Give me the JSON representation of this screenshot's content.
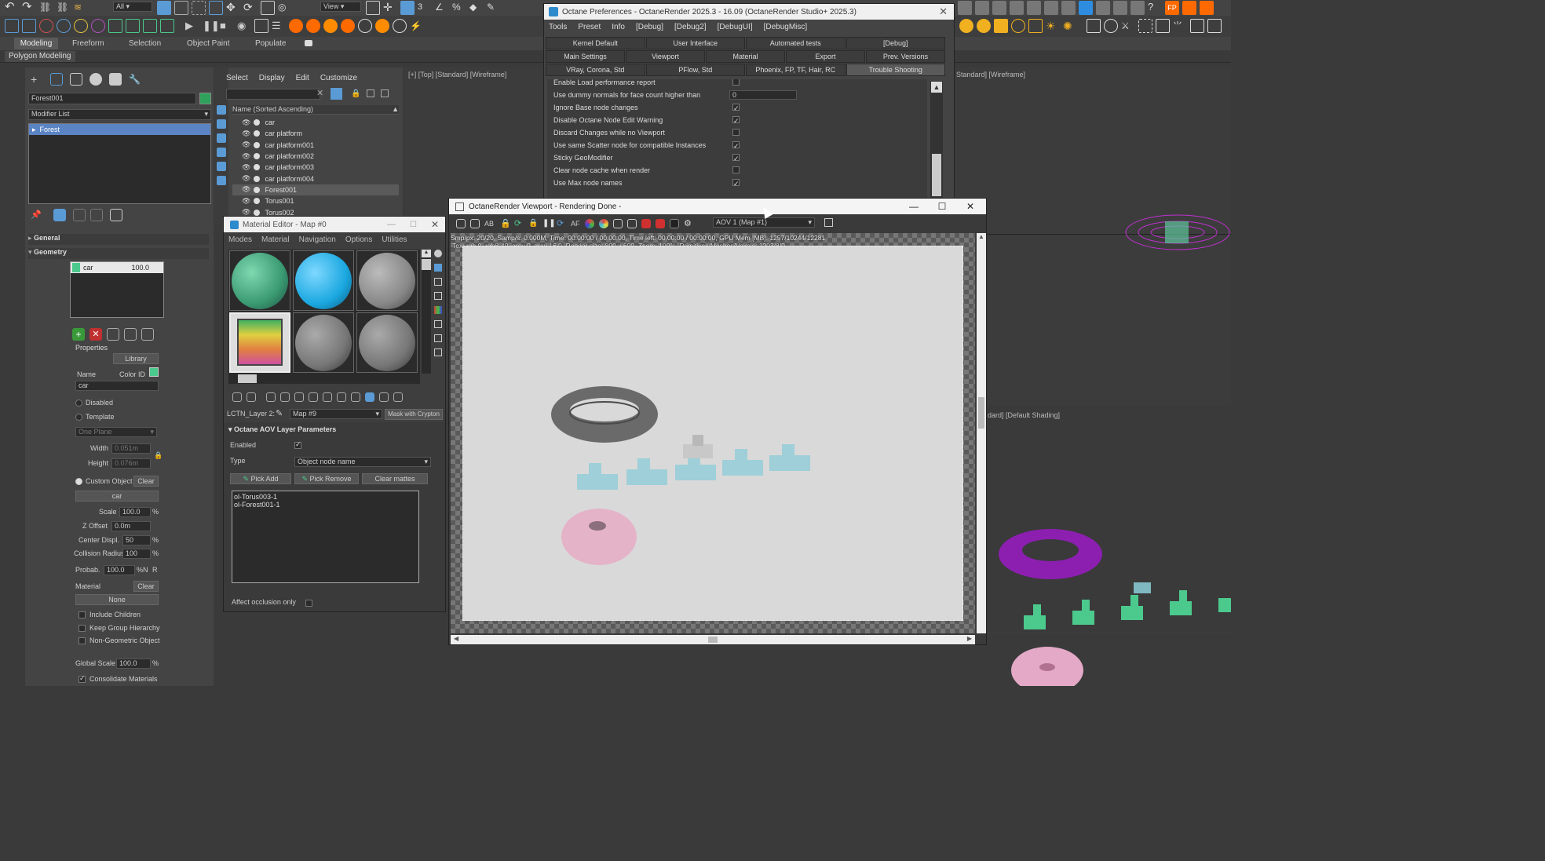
{
  "ribbon": {
    "tabs": [
      "Modeling",
      "Freeform",
      "Selection",
      "Object Paint",
      "Populate"
    ],
    "subtitle": "Polygon Modeling",
    "dropdown_all": "All",
    "dropdown_view": "View"
  },
  "command_panel": {
    "object_name": "Forest001",
    "modifier_list": "Modifier List",
    "stack_item": "Forest",
    "general": "General",
    "geometry": "Geometry",
    "geom_item_name": "car",
    "geom_item_value": "100.0",
    "properties": "Properties",
    "library": "Library",
    "name_label": "Name",
    "colorid_label": "Color ID",
    "name_value": "car",
    "disabled": "Disabled",
    "template": "Template",
    "one_plane": "One Plane",
    "width_label": "Width",
    "width_value": "0.051m",
    "height_label": "Height",
    "height_value": "0.076m",
    "custom_object": "Custom Object",
    "clear": "Clear",
    "custom_value": "car",
    "scale_label": "Scale",
    "scale_value": "100.0",
    "zoffset_label": "Z Offset",
    "zoffset_value": "0.0m",
    "center_label": "Center Displ.",
    "center_value": "50",
    "collision_label": "Collision Radius",
    "collision_value": "100",
    "probab_label": "Probab.",
    "probab_value": "100.0",
    "material_label": "Material",
    "material_value": "None",
    "include_children": "Include Children",
    "keep_group": "Keep Group Hierarchy",
    "non_geometric": "Non-Geometric Object",
    "global_scale_label": "Global Scale",
    "global_scale_value": "100.0",
    "consolidate": "Consolidate Materials",
    "pct": "%",
    "n": "N",
    "r": "R"
  },
  "scene_explorer": {
    "menu": [
      "Select",
      "Display",
      "Edit",
      "Customize"
    ],
    "header": "Name (Sorted Ascending)",
    "rows": [
      "car",
      "car platform",
      "car platform001",
      "car platform002",
      "car platform003",
      "car platform004",
      "Forest001",
      "Torus001",
      "Torus002"
    ]
  },
  "viewport_top_label": "[+] [Top] [Standard] [Wireframe]",
  "viewport_right_label": "Standard] [Wireframe]",
  "viewport_persp_label": "dard] [Default Shading]",
  "prefs": {
    "title": "Octane Preferences - OctaneRender 2025.3 - 16.09 (OctaneRender Studio+ 2025.3)",
    "menu": [
      "Tools",
      "Preset",
      "Info",
      "[Debug]",
      "[Debug2]",
      "[DebugUI]",
      "[DebugMisc]"
    ],
    "tabs_row1": [
      "Kernel Default",
      "User Interface",
      "Automated tests",
      "[Debug]"
    ],
    "tabs_row2": [
      "Main Settings",
      "Viewport",
      "Material",
      "Export",
      "Prev. Versions"
    ],
    "tabs_row3": [
      "VRay, Corona, Std",
      "PFlow, Std",
      "Phoenix, FP, TF, Hair, RC",
      "Trouble Shooting"
    ],
    "options": [
      {
        "label": "Enable Load performance report",
        "checked": false
      },
      {
        "label": "Use dummy normals for face count higher than",
        "value": "0"
      },
      {
        "label": "Ignore Base node changes",
        "checked": true
      },
      {
        "label": "Disable Octane Node Edit Warning",
        "checked": true
      },
      {
        "label": "Discard Changes while no Viewport",
        "checked": false
      },
      {
        "label": "Use same Scatter node for compatible Instances",
        "checked": true
      },
      {
        "label": "Sticky GeoModifier",
        "checked": true
      },
      {
        "label": "Clear node cache when render",
        "checked": false
      },
      {
        "label": "Use Max node names",
        "checked": true
      }
    ]
  },
  "mat_editor": {
    "title": "Material Editor - Map #0",
    "menu": [
      "Modes",
      "Material",
      "Navigation",
      "Options",
      "Utilities"
    ],
    "layer_label": "LCTN_Layer 2:",
    "map_value": "Map #9",
    "mask_btn": "Mask with Crypton",
    "section": "Octane AOV Layer Parameters",
    "enabled_label": "Enabled",
    "type_label": "Type",
    "type_value": "Object node name",
    "pick_add": "Pick Add",
    "pick_remove": "Pick Remove",
    "clear_mattes": "Clear mattes",
    "list": [
      "ol-Torus003-1",
      "ol-Forest001-1"
    ],
    "affect": "Affect occlusion only"
  },
  "octane_vp": {
    "title": "OctaneRender Viewport - Rendering Done -",
    "aov": "AOV 1 (Map #1)",
    "stats1": "Smp/px: 20/20,  Samp/s: 0.000M,  Time: 00:00:00 / 00:00:00,  Time left: 00:00:00 / 00:00:00,  GPU Mem [MB]: 1257/10244/12281",
    "stats2": "Tex: rgb 0, rgb8-40, grey 0, grey 16 0,  Render size: 800 x 600,  Zoom: 100%,  Primitives/Meshes/Voxels: 1203/8/0"
  },
  "colors": {
    "accent": "#5b9bd5",
    "green": "#4cc98d",
    "purple": "#8c1fb0",
    "pink": "#e4a9c7",
    "cyan": "#8fd6df",
    "orange": "#ff6a00"
  }
}
